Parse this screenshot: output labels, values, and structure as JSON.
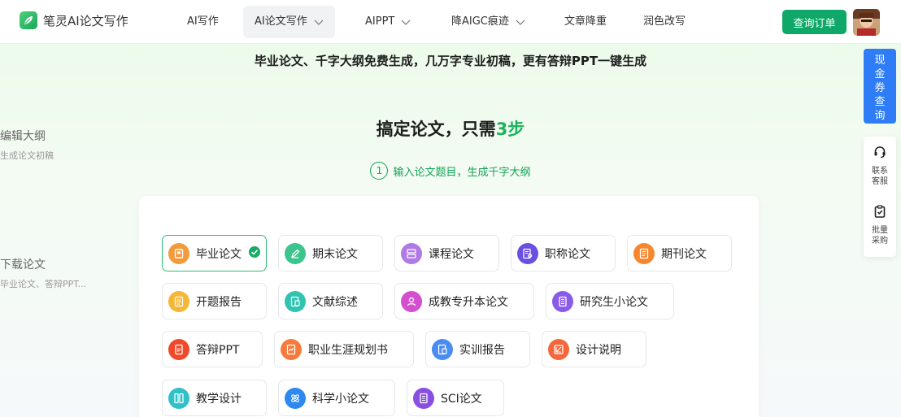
{
  "header": {
    "brand": "笔灵AI论文写作",
    "nav": [
      {
        "label": "AI写作"
      },
      {
        "label": "AI论文写作"
      },
      {
        "label": "AIPPT"
      },
      {
        "label": "降AIGC痕迹"
      },
      {
        "label": "文章降重"
      },
      {
        "label": "润色改写"
      }
    ],
    "orders_button": "查询订单"
  },
  "tagline": "毕业论文、千字大纲免费生成，几万字专业初稿，更有答辩PPT一键生成",
  "hero": {
    "title_prefix": "搞定论文，只需",
    "title_highlight": "3步",
    "step_number": "1",
    "step_text": "输入论文题目，生成千字大纲"
  },
  "side_steps": [
    {
      "title": "编辑大纲",
      "subtitle": "生成论文初稿"
    },
    {
      "title": "下载论文",
      "subtitle": "毕业论文、答辩PPT..."
    }
  ],
  "paper_types": [
    {
      "label": "毕业论文",
      "icon": "book-icon",
      "color": "#f39a3c",
      "selected": true
    },
    {
      "label": "期末论文",
      "icon": "pen-icon",
      "color": "#3cc48d"
    },
    {
      "label": "课程论文",
      "icon": "layers-icon",
      "color": "#b07ae6"
    },
    {
      "label": "职称论文",
      "icon": "document-search-icon",
      "color": "#6a4fe0"
    },
    {
      "label": "期刊论文",
      "icon": "journal-icon",
      "color": "#f5872f"
    },
    {
      "label": "开题报告",
      "icon": "report-icon",
      "color": "#f6b636"
    },
    {
      "label": "文献综述",
      "icon": "literature-icon",
      "color": "#2fc3b0"
    },
    {
      "label": "成教专升本论文",
      "icon": "graduate-icon",
      "color": "#d44fd0"
    },
    {
      "label": "研究生小论文",
      "icon": "research-icon",
      "color": "#8a5ce6"
    },
    {
      "label": "答辩PPT",
      "icon": "ppt-icon",
      "color": "#f04a2a"
    },
    {
      "label": "职业生涯规划书",
      "icon": "career-icon",
      "color": "#f57a3c"
    },
    {
      "label": "实训报告",
      "icon": "training-icon",
      "color": "#4a8cf0"
    },
    {
      "label": "设计说明",
      "icon": "design-icon",
      "color": "#f5663a"
    },
    {
      "label": "教学设计",
      "icon": "teaching-icon",
      "color": "#2fc0c8"
    },
    {
      "label": "科学小论文",
      "icon": "atom-icon",
      "color": "#2e88f0"
    },
    {
      "label": "SCI论文",
      "icon": "sci-icon",
      "color": "#8a4fe0"
    }
  ],
  "right_panel": {
    "coupon": [
      "现",
      "金",
      "券",
      "查",
      "询"
    ],
    "service": [
      "联系",
      "客服"
    ],
    "bulk": [
      "批量",
      "采购"
    ]
  },
  "colors": {
    "primary": "#0fa868",
    "accent_green": "#1bb35c",
    "coupon_blue": "#2e7cf6"
  }
}
